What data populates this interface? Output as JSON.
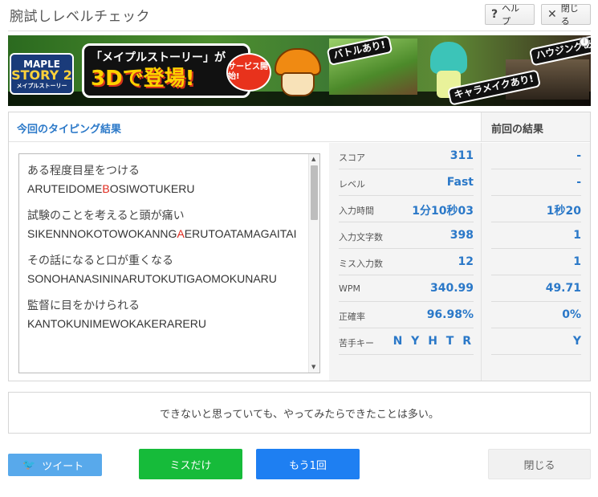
{
  "header": {
    "title": "腕試しレベルチェック",
    "help_icon": "?",
    "help_label": "ヘルプ",
    "close_icon": "✕",
    "close_label": "閉じる"
  },
  "banner": {
    "logo_top": "MAPLE",
    "logo_mid": "STORY 2",
    "logo_sub": "メイプルストーリー",
    "headline_top": "「メイプルストーリー」が",
    "headline_main": "3Dで登場!",
    "service": "サービス開始!",
    "tag_battle": "バトルあり!",
    "tag_chara": "キャラメイクあり!",
    "tag_housing": "ハウジングあり!",
    "ad_mark": "i"
  },
  "results": {
    "current_title": "今回のタイピング結果",
    "previous_title": "前回の結果",
    "entries": [
      {
        "jp": "ある程度目星をつける",
        "ro_before": "ARUTEIDOME",
        "ro_miss": "B",
        "ro_after": "OSIWOTUKERU"
      },
      {
        "jp": "試験のことを考えると頭が痛い",
        "ro_before": "SIKENNNOKOTOWOKANNG",
        "ro_miss": "A",
        "ro_after": "ERUTOATAMAGAITAI"
      },
      {
        "jp": "その話になると口が重くなる",
        "ro_before": "SONOHANASININARUTOKUTIGAOMOKUNARU",
        "ro_miss": "",
        "ro_after": ""
      },
      {
        "jp": "監督に目をかけられる",
        "ro_before": "KANTOKUNIMEWOKAKERARERU",
        "ro_miss": "",
        "ro_after": ""
      }
    ],
    "stats": [
      {
        "label": "スコア",
        "current": "311",
        "previous": "-"
      },
      {
        "label": "レベル",
        "current": "Fast",
        "previous": "-"
      },
      {
        "label": "入力時間",
        "current": "1分10秒03",
        "previous": "1秒20"
      },
      {
        "label": "入力文字数",
        "current": "398",
        "previous": "1"
      },
      {
        "label": "ミス入力数",
        "current": "12",
        "previous": "1"
      },
      {
        "label": "WPM",
        "current": "340.99",
        "previous": "49.71"
      },
      {
        "label": "正確率",
        "current": "96.98%",
        "previous": "0%"
      },
      {
        "label": "苦手キー",
        "current": "N Y H T R",
        "previous": "Y"
      }
    ]
  },
  "quote": "できないと思っていても、やってみたらできたことは多い。",
  "buttons": {
    "tweet": "ツイート",
    "miss_only": "ミスだけ",
    "retry": "もう1回",
    "close": "閉じる"
  }
}
